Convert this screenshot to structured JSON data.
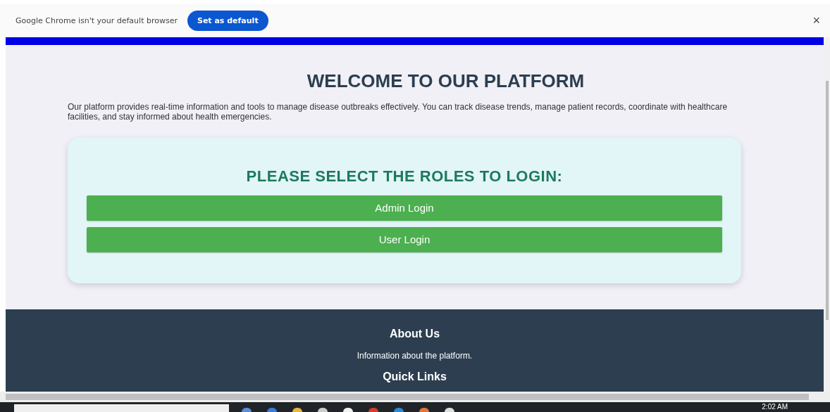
{
  "infobar": {
    "message": "Google Chrome isn't your default browser",
    "button": "Set as default",
    "close": "×"
  },
  "page": {
    "title": "WELCOME TO OUR PLATFORM",
    "intro": "Our platform provides real-time information and tools to manage disease outbreaks effectively. You can track disease trends, manage patient records, coordinate with healthcare facilities, and stay informed about health emergencies.",
    "login_card": {
      "heading": "PLEASE SELECT THE ROLES TO LOGIN:",
      "buttons": [
        "Admin Login",
        "User Login"
      ]
    }
  },
  "footer": {
    "sections": [
      {
        "kind": "heading",
        "text": "About Us"
      },
      {
        "kind": "text",
        "text": "Information about the platform."
      },
      {
        "kind": "heading",
        "text": "Quick Links"
      }
    ]
  },
  "taskbar": {
    "clock": "2:02 AM"
  }
}
